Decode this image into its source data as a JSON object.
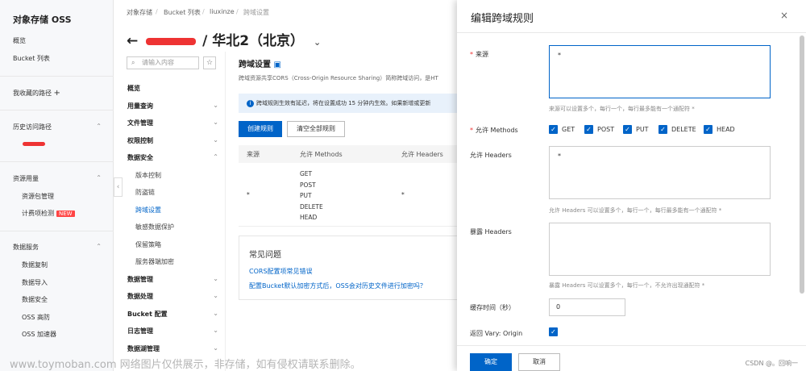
{
  "leftnav": {
    "title": "对象存储 OSS",
    "items": [
      {
        "label": "概览"
      },
      {
        "label": "Bucket 列表"
      }
    ],
    "favorites_label": "我收藏的路径",
    "favorites_add": "+",
    "history_label": "历史访问路径",
    "resource_label": "资源用量",
    "resource_items": [
      {
        "label": "资源包管理"
      },
      {
        "label": "计费项检测"
      }
    ],
    "new_badge": "NEW",
    "data_service_label": "数据服务",
    "data_items": [
      {
        "label": "数据复制"
      },
      {
        "label": "数据导入"
      },
      {
        "label": "数据安全"
      },
      {
        "label": "OSS 高防"
      },
      {
        "label": "OSS 加速器"
      }
    ]
  },
  "breadcrumb": [
    "对象存储",
    "Bucket 列表",
    "liuxinze",
    "跨域设置"
  ],
  "page_title": "/ 华北2（北京）",
  "back_arrow": "←",
  "subnav": {
    "search_placeholder": "请输入内容",
    "star": "☆",
    "items": [
      {
        "label": "概览",
        "type": "b"
      },
      {
        "label": "用量查询",
        "type": "b",
        "chev": "⌄"
      },
      {
        "label": "文件管理",
        "type": "b",
        "chev": "⌄"
      },
      {
        "label": "权限控制",
        "type": "b",
        "chev": "⌄"
      },
      {
        "label": "数据安全",
        "type": "b",
        "chev": "⌃"
      },
      {
        "label": "版本控制",
        "type": "s"
      },
      {
        "label": "防盗链",
        "type": "s"
      },
      {
        "label": "跨域设置",
        "type": "s",
        "active": true
      },
      {
        "label": "敏感数据保护",
        "type": "s"
      },
      {
        "label": "保留策略",
        "type": "s"
      },
      {
        "label": "服务器端加密",
        "type": "s"
      },
      {
        "label": "数据管理",
        "type": "b",
        "chev": "⌄"
      },
      {
        "label": "数据处理",
        "type": "b",
        "chev": "⌄"
      },
      {
        "label": "Bucket 配置",
        "type": "b",
        "chev": "⌄"
      },
      {
        "label": "日志管理",
        "type": "b",
        "chev": "⌄"
      },
      {
        "label": "数据湖管理",
        "type": "b",
        "chev": "⌄"
      }
    ]
  },
  "main": {
    "section_title": "跨域设置",
    "section_desc": "跨域资源共享CORS（Cross-Origin Resource Sharing）简称跨域访问，是HT",
    "info": "跨域规则生效有延迟，将在设置成功 15 分钟内生效。如果新增或更新",
    "create_button": "创建规则",
    "clear_button": "清空全部规则",
    "table": {
      "headers": [
        "来源",
        "允许 Methods",
        "允许 Headers"
      ],
      "row": {
        "origin": "*",
        "methods": [
          "GET",
          "POST",
          "PUT",
          "DELETE",
          "HEAD"
        ],
        "headers": "*"
      }
    },
    "faq": {
      "title": "常见问题",
      "links": [
        "CORS配置项常见错误",
        "配置Bucket默认加密方式后，OSS会对历史文件进行加密吗？"
      ]
    }
  },
  "drawer": {
    "title": "编辑跨域规则",
    "close": "×",
    "origin_label": "来源",
    "origin_value": "*",
    "origin_hint": "来源可以设置多个，每行一个，每行最多能有一个通配符 *",
    "methods_label": "允许 Methods",
    "methods": [
      "GET",
      "POST",
      "PUT",
      "DELETE",
      "HEAD"
    ],
    "allow_headers_label": "允许 Headers",
    "allow_headers_value": "*",
    "allow_headers_hint": "允许 Headers 可以设置多个，每行一个，每行最多能有一个通配符 *",
    "expose_headers_label": "暴露 Headers",
    "expose_headers_value": "",
    "expose_headers_hint": "暴露 Headers 可以设置多个，每行一个，不允许出现通配符 *",
    "cache_label": "缓存时间（秒）",
    "cache_value": "0",
    "vary_label": "返回 Vary: Origin",
    "ok_button": "确定",
    "cancel_button": "取消",
    "credit": "CSDN @。回响一"
  },
  "watermark": "www.toymoban.com 网络图片仅供展示，非存储，如有侵权请联系删除。",
  "colors": {
    "accent": "#0064c8",
    "badge": "#ff4444"
  }
}
